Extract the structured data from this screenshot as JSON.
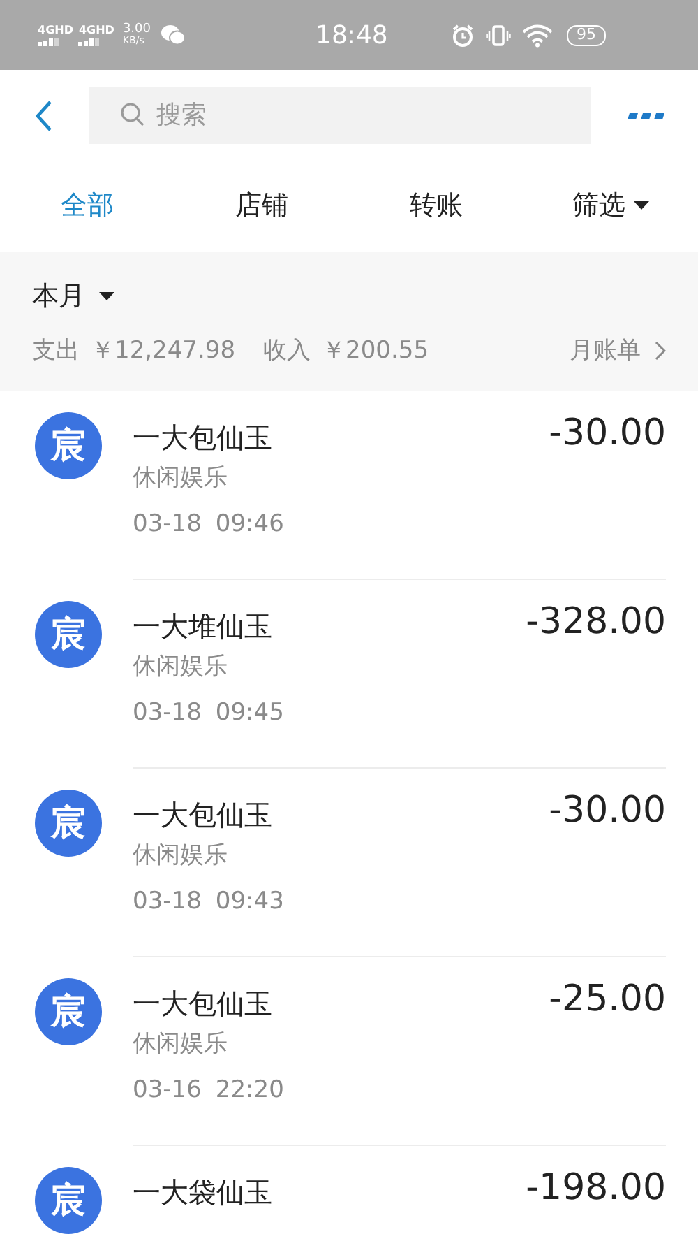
{
  "status_bar": {
    "networks": [
      "4GHD",
      "4GHD"
    ],
    "speed": "3.00",
    "speed_unit": "KB/s",
    "time": "18:48",
    "battery": "95"
  },
  "header": {
    "search": {
      "placeholder": "搜索"
    }
  },
  "tabs": [
    {
      "label": "全部",
      "selected": true,
      "dropdown": false
    },
    {
      "label": "店铺",
      "selected": false,
      "dropdown": false
    },
    {
      "label": "转账",
      "selected": false,
      "dropdown": false
    },
    {
      "label": "筛选",
      "selected": false,
      "dropdown": true
    }
  ],
  "summary": {
    "period": "本月",
    "expense_label": "支出",
    "expense": "￥12,247.98",
    "income_label": "收入",
    "income": "￥200.55",
    "monthly_bill": "月账单"
  },
  "transactions": [
    {
      "avatar": "宸",
      "title": "一大包仙玉",
      "category": "休闲娱乐",
      "date": "03-18",
      "time": "09:46",
      "amount": "-30.00"
    },
    {
      "avatar": "宸",
      "title": "一大堆仙玉",
      "category": "休闲娱乐",
      "date": "03-18",
      "time": "09:45",
      "amount": "-328.00"
    },
    {
      "avatar": "宸",
      "title": "一大包仙玉",
      "category": "休闲娱乐",
      "date": "03-18",
      "time": "09:43",
      "amount": "-30.00"
    },
    {
      "avatar": "宸",
      "title": "一大包仙玉",
      "category": "休闲娱乐",
      "date": "03-16",
      "time": "22:20",
      "amount": "-25.00"
    },
    {
      "avatar": "宸",
      "title": "一大袋仙玉",
      "amount": "-198.00"
    }
  ]
}
